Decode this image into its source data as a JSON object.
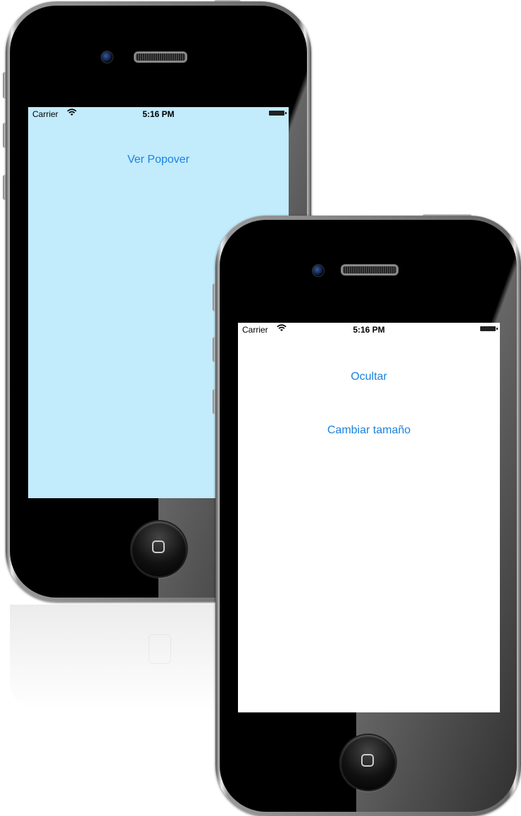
{
  "devices": [
    {
      "status_bar": {
        "carrier": "Carrier",
        "wifi_icon": "wifi-icon",
        "time": "5:16 PM",
        "battery_icon": "battery-icon"
      },
      "screen_color": "#c2ebfb",
      "buttons": [
        "Ver Popover"
      ]
    },
    {
      "status_bar": {
        "carrier": "Carrier",
        "wifi_icon": "wifi-icon",
        "time": "5:16 PM",
        "battery_icon": "battery-icon"
      },
      "screen_color": "#ffffff",
      "buttons": [
        "Ocultar",
        "Cambiar tamaño"
      ]
    }
  ],
  "colors": {
    "button_text": "#1a82e0",
    "device_body": "#000000"
  }
}
